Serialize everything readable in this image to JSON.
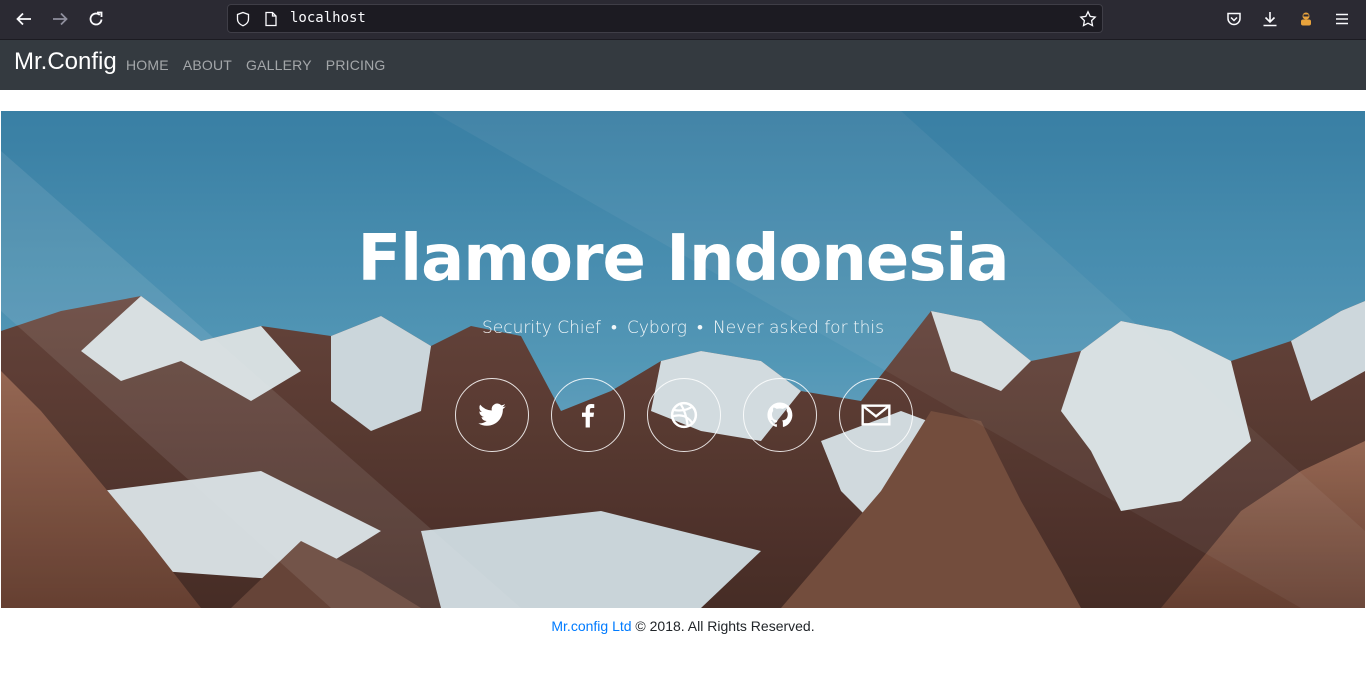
{
  "browser": {
    "url": "localhost"
  },
  "navbar": {
    "brand": "Mr.Config",
    "links": [
      "HOME",
      "ABOUT",
      "GALLERY",
      "PRICING"
    ]
  },
  "hero": {
    "title": "Flamore Indonesia",
    "subtitle": [
      "Security Chief",
      "Cyborg",
      "Never asked for this"
    ],
    "separator": "•",
    "socials": [
      "twitter-icon",
      "facebook-icon",
      "dribbble-icon",
      "github-icon",
      "envelope-icon"
    ]
  },
  "footer": {
    "company_link": "Mr.config Ltd",
    "rights": "© 2018. All Rights Reserved."
  },
  "colors": {
    "navbar": "#343a40",
    "browser_chrome": "#2b2a33",
    "link": "#007bff",
    "sky": "#4a93b8"
  }
}
